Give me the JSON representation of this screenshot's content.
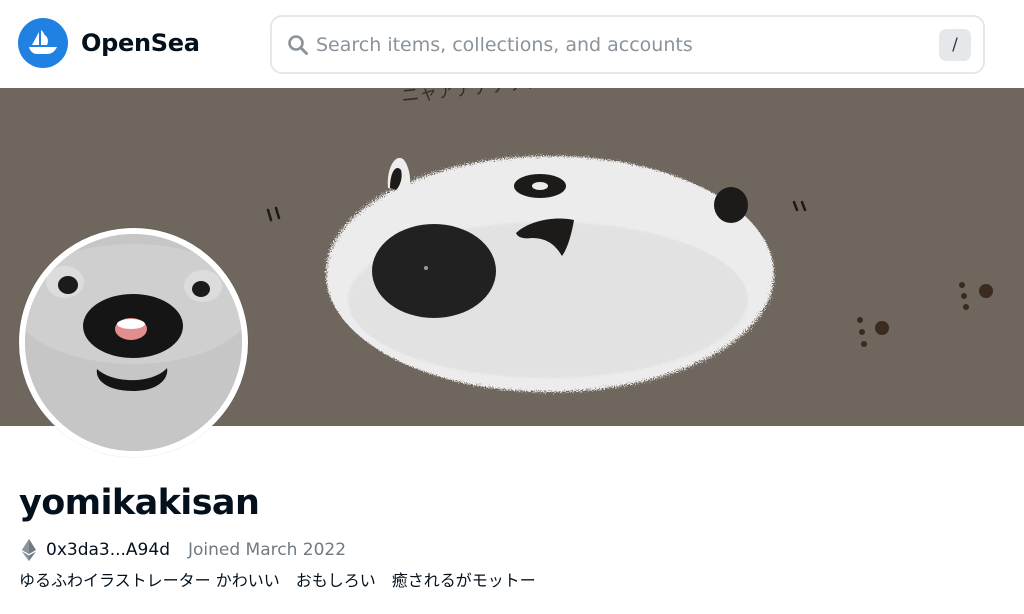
{
  "header": {
    "brand_name": "OpenSea",
    "logo_icon": "opensea-ship-icon",
    "search": {
      "placeholder": "Search items, collections, and accounts",
      "value": "",
      "shortcut_key": "/",
      "icon": "search-icon"
    }
  },
  "banner": {
    "image": "panda-illustration-banner",
    "handwritten_text": "ニャアアアアア…"
  },
  "profile": {
    "avatar": "panda-face-avatar",
    "username": "yomikakisan",
    "chain_icon": "ethereum-icon",
    "wallet_address": "0x3da3...A94d",
    "joined": "Joined March 2022",
    "bio": "ゆるふわイラストレーター かわいい　おもしろい　癒されるがモットー"
  },
  "colors": {
    "brand_blue": "#2081e2",
    "banner_bg": "#6f665d",
    "text_primary": "#04111d",
    "text_secondary": "#707a83",
    "search_border": "#e5e8eb"
  }
}
